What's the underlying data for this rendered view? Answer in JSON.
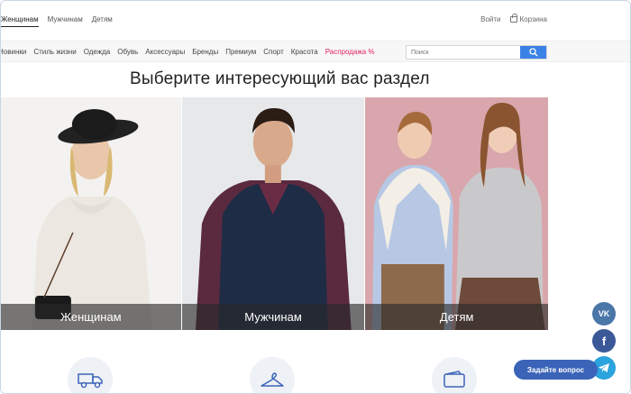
{
  "header": {
    "gender_tabs": [
      "Женщинам",
      "Мужчинам",
      "Детям"
    ],
    "login": "Войти",
    "cart": "Корзина"
  },
  "categories": [
    "Новинки",
    "Стиль жизни",
    "Одежда",
    "Обувь",
    "Аксессуары",
    "Бренды",
    "Премиум",
    "Спорт",
    "Красота",
    "Распродажа %"
  ],
  "search": {
    "placeholder": "Поиск"
  },
  "main": {
    "heading": "Выберите интересующий вас раздел",
    "panels": [
      {
        "label": "Женщинам"
      },
      {
        "label": "Мужчинам"
      },
      {
        "label": "Детям"
      }
    ]
  },
  "widgets": {
    "ask_button": "Задайте вопрос",
    "socials": [
      {
        "name": "vk",
        "text": "VK",
        "color": "#4a76a8"
      },
      {
        "name": "facebook",
        "text": "f",
        "color": "#3b5998"
      },
      {
        "name": "telegram",
        "text": "",
        "color": "#2aa3de"
      }
    ]
  },
  "colors": {
    "accent": "#3b82e6",
    "sale": "#e0245e"
  }
}
